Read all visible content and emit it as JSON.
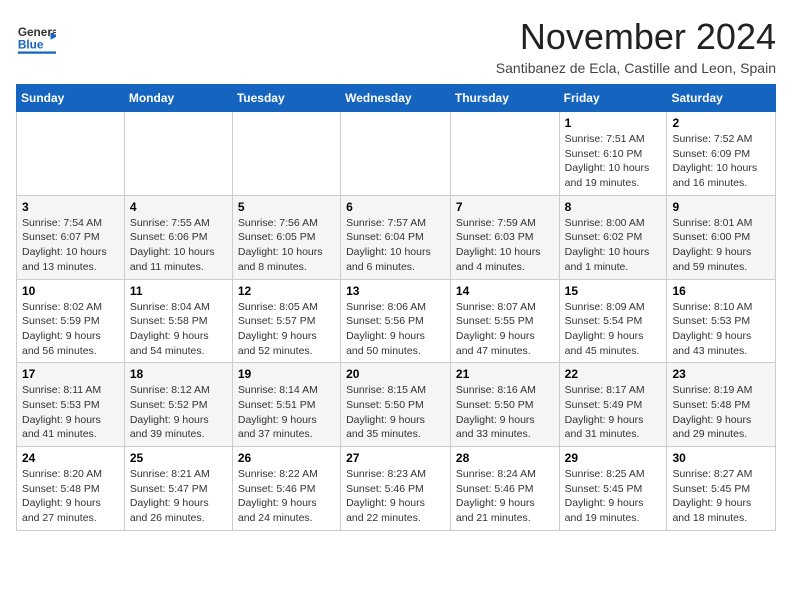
{
  "header": {
    "logo_general": "General",
    "logo_blue": "Blue",
    "month_title": "November 2024",
    "subtitle": "Santibanez de Ecla, Castille and Leon, Spain"
  },
  "days_of_week": [
    "Sunday",
    "Monday",
    "Tuesday",
    "Wednesday",
    "Thursday",
    "Friday",
    "Saturday"
  ],
  "weeks": [
    {
      "days": [
        {
          "num": "",
          "info": ""
        },
        {
          "num": "",
          "info": ""
        },
        {
          "num": "",
          "info": ""
        },
        {
          "num": "",
          "info": ""
        },
        {
          "num": "",
          "info": ""
        },
        {
          "num": "1",
          "info": "Sunrise: 7:51 AM\nSunset: 6:10 PM\nDaylight: 10 hours and 19 minutes."
        },
        {
          "num": "2",
          "info": "Sunrise: 7:52 AM\nSunset: 6:09 PM\nDaylight: 10 hours and 16 minutes."
        }
      ]
    },
    {
      "days": [
        {
          "num": "3",
          "info": "Sunrise: 7:54 AM\nSunset: 6:07 PM\nDaylight: 10 hours and 13 minutes."
        },
        {
          "num": "4",
          "info": "Sunrise: 7:55 AM\nSunset: 6:06 PM\nDaylight: 10 hours and 11 minutes."
        },
        {
          "num": "5",
          "info": "Sunrise: 7:56 AM\nSunset: 6:05 PM\nDaylight: 10 hours and 8 minutes."
        },
        {
          "num": "6",
          "info": "Sunrise: 7:57 AM\nSunset: 6:04 PM\nDaylight: 10 hours and 6 minutes."
        },
        {
          "num": "7",
          "info": "Sunrise: 7:59 AM\nSunset: 6:03 PM\nDaylight: 10 hours and 4 minutes."
        },
        {
          "num": "8",
          "info": "Sunrise: 8:00 AM\nSunset: 6:02 PM\nDaylight: 10 hours and 1 minute."
        },
        {
          "num": "9",
          "info": "Sunrise: 8:01 AM\nSunset: 6:00 PM\nDaylight: 9 hours and 59 minutes."
        }
      ]
    },
    {
      "days": [
        {
          "num": "10",
          "info": "Sunrise: 8:02 AM\nSunset: 5:59 PM\nDaylight: 9 hours and 56 minutes."
        },
        {
          "num": "11",
          "info": "Sunrise: 8:04 AM\nSunset: 5:58 PM\nDaylight: 9 hours and 54 minutes."
        },
        {
          "num": "12",
          "info": "Sunrise: 8:05 AM\nSunset: 5:57 PM\nDaylight: 9 hours and 52 minutes."
        },
        {
          "num": "13",
          "info": "Sunrise: 8:06 AM\nSunset: 5:56 PM\nDaylight: 9 hours and 50 minutes."
        },
        {
          "num": "14",
          "info": "Sunrise: 8:07 AM\nSunset: 5:55 PM\nDaylight: 9 hours and 47 minutes."
        },
        {
          "num": "15",
          "info": "Sunrise: 8:09 AM\nSunset: 5:54 PM\nDaylight: 9 hours and 45 minutes."
        },
        {
          "num": "16",
          "info": "Sunrise: 8:10 AM\nSunset: 5:53 PM\nDaylight: 9 hours and 43 minutes."
        }
      ]
    },
    {
      "days": [
        {
          "num": "17",
          "info": "Sunrise: 8:11 AM\nSunset: 5:53 PM\nDaylight: 9 hours and 41 minutes."
        },
        {
          "num": "18",
          "info": "Sunrise: 8:12 AM\nSunset: 5:52 PM\nDaylight: 9 hours and 39 minutes."
        },
        {
          "num": "19",
          "info": "Sunrise: 8:14 AM\nSunset: 5:51 PM\nDaylight: 9 hours and 37 minutes."
        },
        {
          "num": "20",
          "info": "Sunrise: 8:15 AM\nSunset: 5:50 PM\nDaylight: 9 hours and 35 minutes."
        },
        {
          "num": "21",
          "info": "Sunrise: 8:16 AM\nSunset: 5:50 PM\nDaylight: 9 hours and 33 minutes."
        },
        {
          "num": "22",
          "info": "Sunrise: 8:17 AM\nSunset: 5:49 PM\nDaylight: 9 hours and 31 minutes."
        },
        {
          "num": "23",
          "info": "Sunrise: 8:19 AM\nSunset: 5:48 PM\nDaylight: 9 hours and 29 minutes."
        }
      ]
    },
    {
      "days": [
        {
          "num": "24",
          "info": "Sunrise: 8:20 AM\nSunset: 5:48 PM\nDaylight: 9 hours and 27 minutes."
        },
        {
          "num": "25",
          "info": "Sunrise: 8:21 AM\nSunset: 5:47 PM\nDaylight: 9 hours and 26 minutes."
        },
        {
          "num": "26",
          "info": "Sunrise: 8:22 AM\nSunset: 5:46 PM\nDaylight: 9 hours and 24 minutes."
        },
        {
          "num": "27",
          "info": "Sunrise: 8:23 AM\nSunset: 5:46 PM\nDaylight: 9 hours and 22 minutes."
        },
        {
          "num": "28",
          "info": "Sunrise: 8:24 AM\nSunset: 5:46 PM\nDaylight: 9 hours and 21 minutes."
        },
        {
          "num": "29",
          "info": "Sunrise: 8:25 AM\nSunset: 5:45 PM\nDaylight: 9 hours and 19 minutes."
        },
        {
          "num": "30",
          "info": "Sunrise: 8:27 AM\nSunset: 5:45 PM\nDaylight: 9 hours and 18 minutes."
        }
      ]
    }
  ]
}
